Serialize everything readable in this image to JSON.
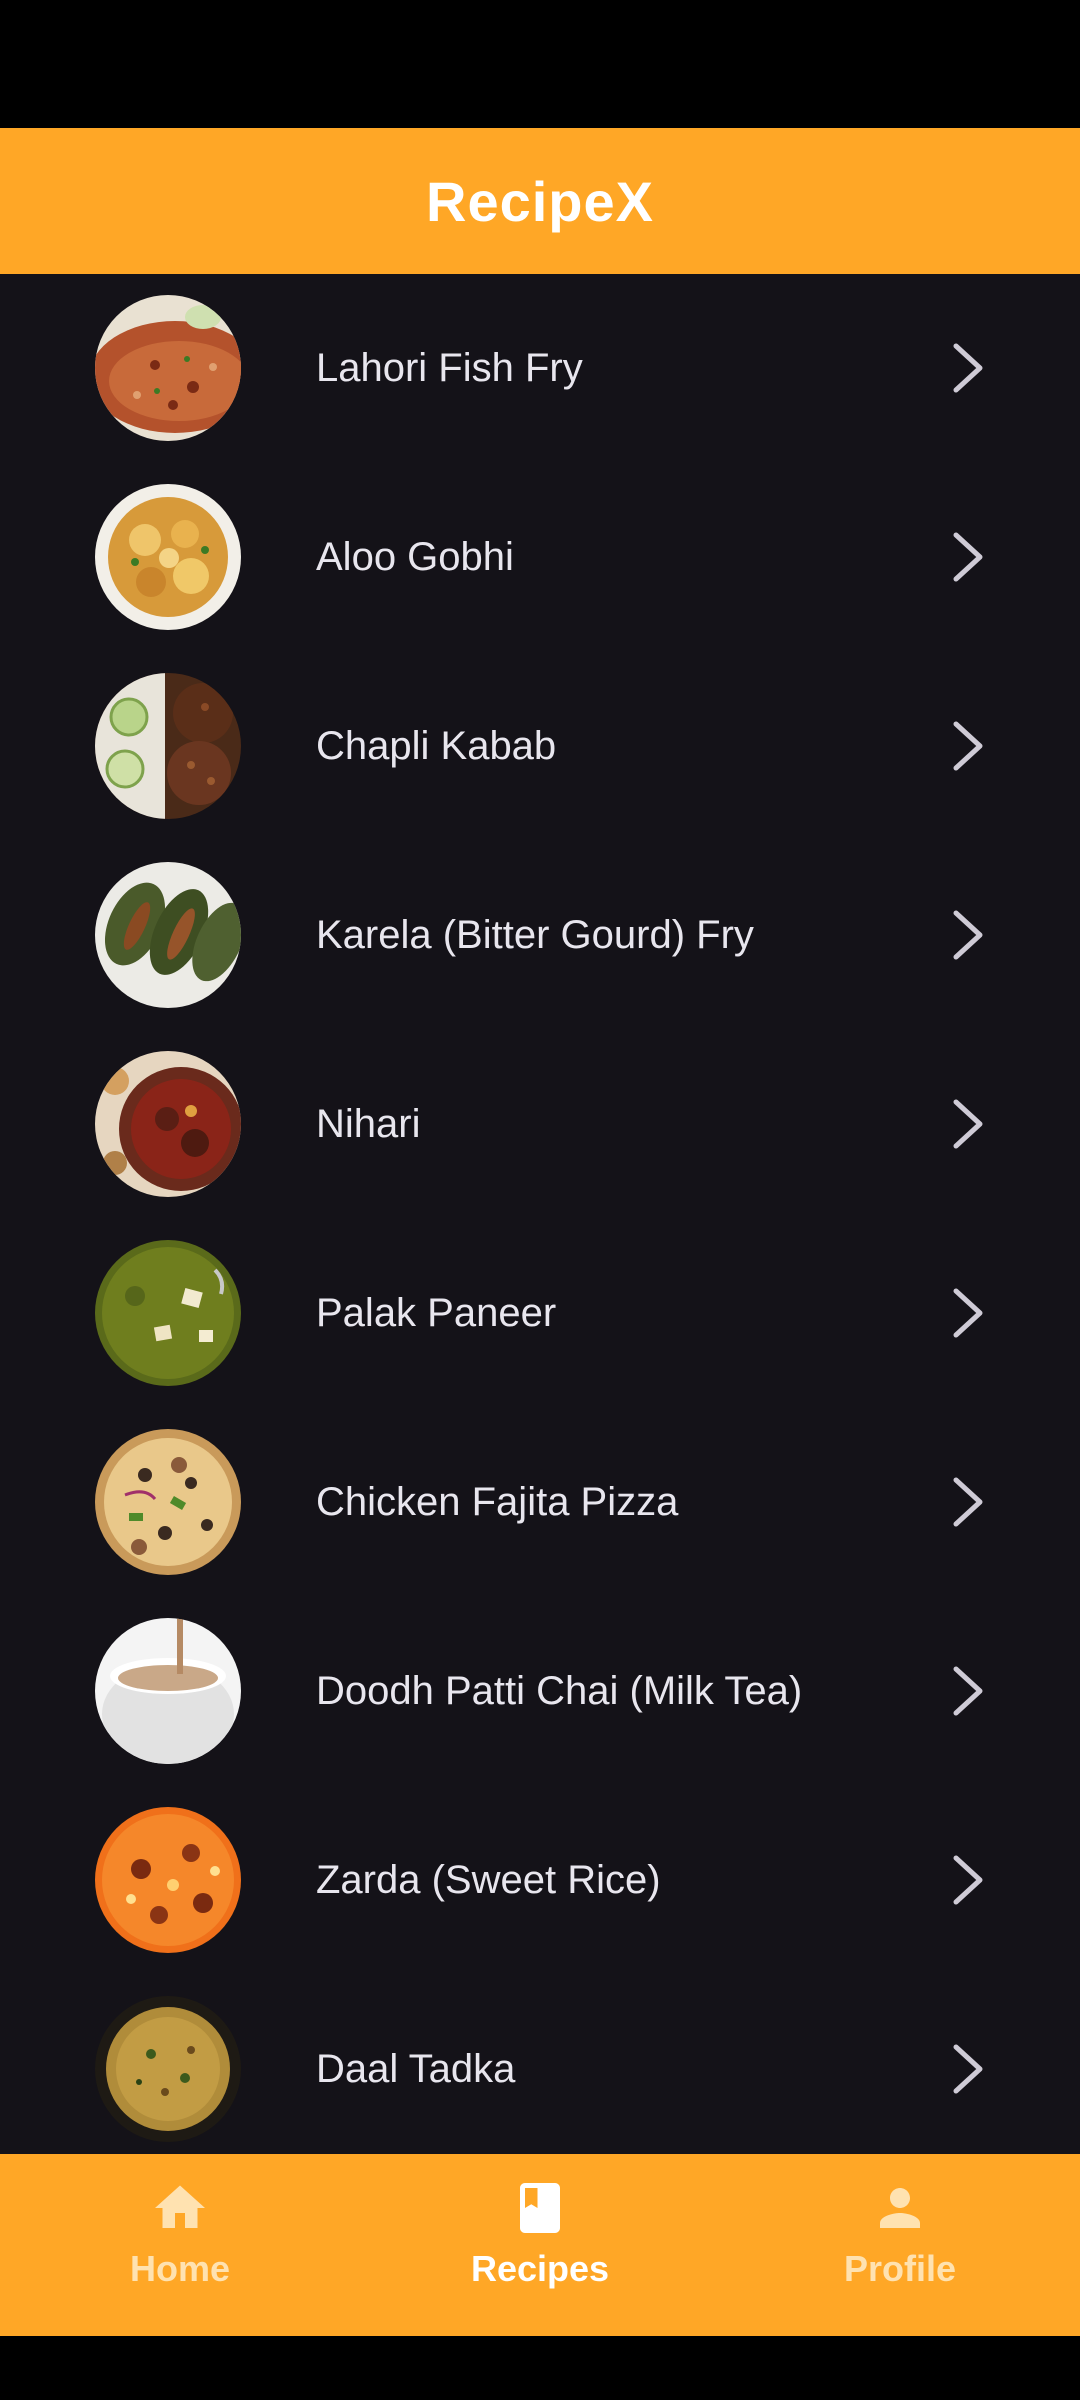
{
  "app": {
    "title": "RecipeX"
  },
  "colors": {
    "accent": "#FFA726",
    "background": "#141218",
    "item_text": "#E8E6EE",
    "chevron": "#CFCBD6",
    "nav_active": "#FFFFFF",
    "nav_inactive": "#FFE2B0"
  },
  "recipes": [
    {
      "name": "Lahori Fish Fry",
      "icon": "fish-fry-photo"
    },
    {
      "name": "Aloo Gobhi",
      "icon": "aloo-gobhi-photo"
    },
    {
      "name": "Chapli Kabab",
      "icon": "chapli-kabab-photo"
    },
    {
      "name": "Karela (Bitter Gourd) Fry",
      "icon": "karela-fry-photo"
    },
    {
      "name": "Nihari",
      "icon": "nihari-photo"
    },
    {
      "name": "Palak Paneer",
      "icon": "palak-paneer-photo"
    },
    {
      "name": "Chicken Fajita Pizza",
      "icon": "fajita-pizza-photo"
    },
    {
      "name": "Doodh Patti Chai (Milk Tea)",
      "icon": "milk-tea-photo"
    },
    {
      "name": "Zarda (Sweet Rice)",
      "icon": "zarda-photo"
    },
    {
      "name": "Daal Tadka",
      "icon": "daal-tadka-photo"
    }
  ],
  "bottom_nav": {
    "items": [
      {
        "label": "Home",
        "icon": "home-icon",
        "active": false
      },
      {
        "label": "Recipes",
        "icon": "book-icon",
        "active": true
      },
      {
        "label": "Profile",
        "icon": "person-icon",
        "active": false
      }
    ]
  }
}
